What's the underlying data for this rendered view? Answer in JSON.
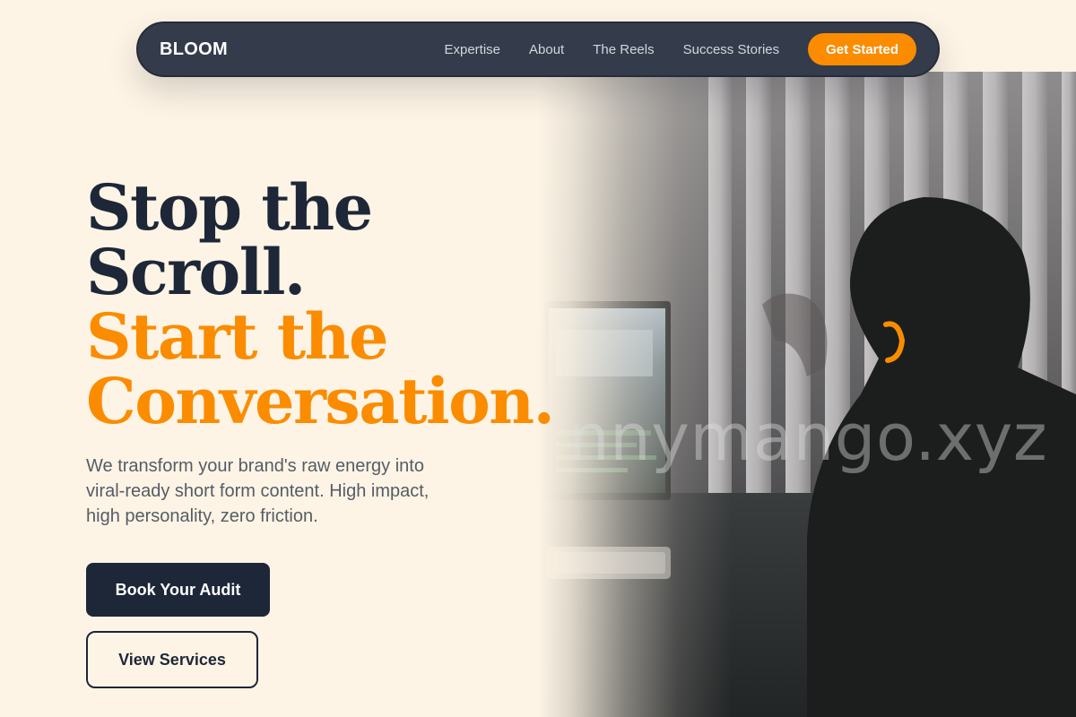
{
  "brand": {
    "name": "BLOOM"
  },
  "nav": {
    "links": [
      "Expertise",
      "About",
      "The Reels",
      "Success Stories"
    ],
    "cta_label": "Get Started"
  },
  "hero": {
    "headline_line1": "Stop the",
    "headline_line2": "Scroll.",
    "accent_line1": "Start the",
    "accent_line2": "Conversation.",
    "subtext": "We transform your brand's raw energy into viral-ready short form content. High impact, high personality, zero friction.",
    "primary_button": "Book Your Audit",
    "secondary_button": "View Services",
    "image_watermark": "nnymango.xyz"
  },
  "colors": {
    "background": "#fdf4e5",
    "navbar": "#343b4a",
    "accent": "#fb8c00",
    "text_dark": "#1e2738",
    "text_body": "#555c66"
  }
}
